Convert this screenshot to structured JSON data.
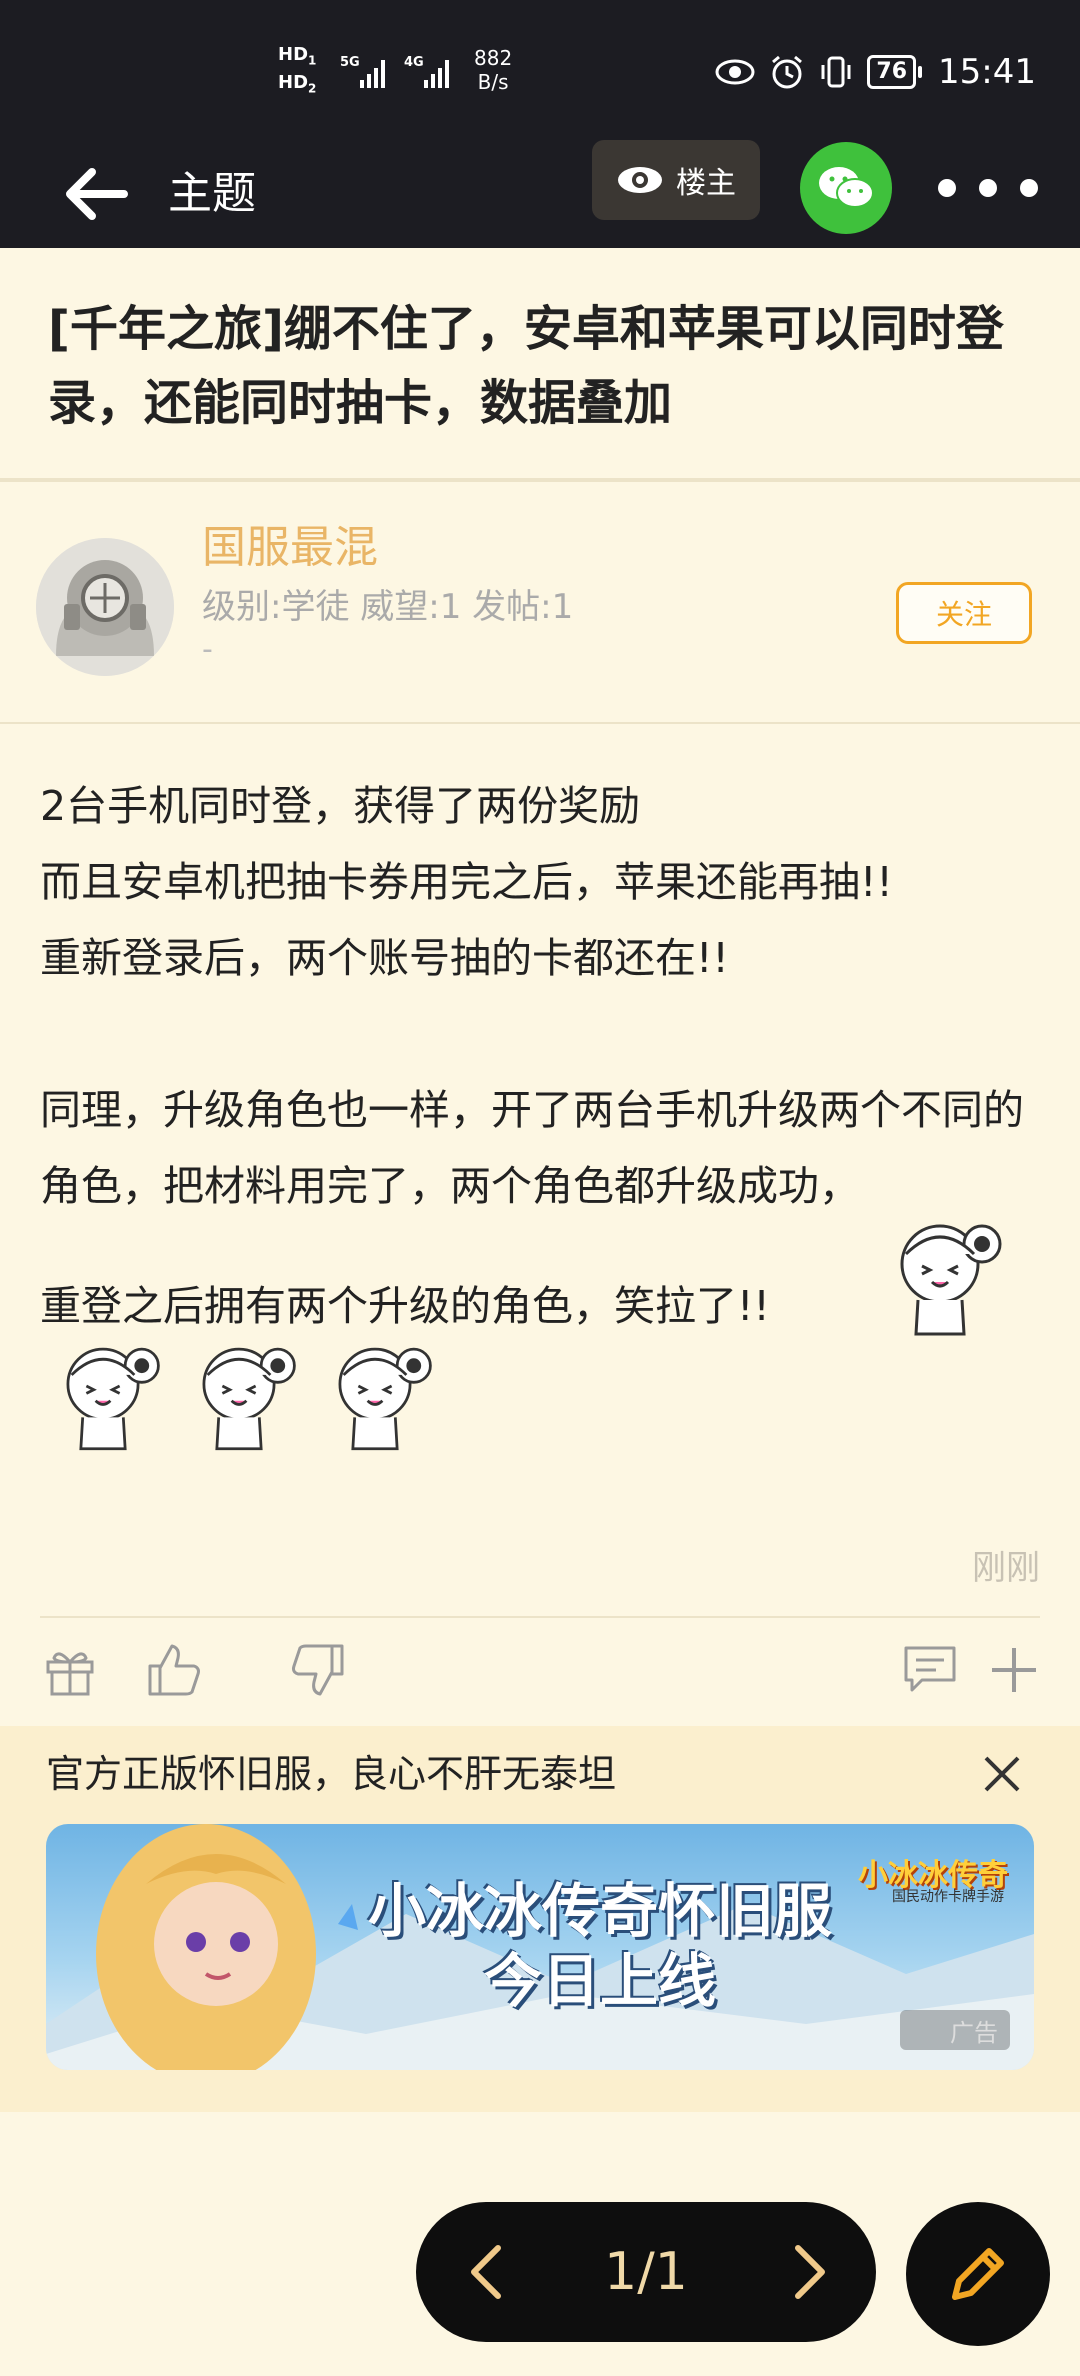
{
  "status_bar": {
    "net_label_1": "HD",
    "net_label_2": "HD",
    "sig1": "5G",
    "sig2": "4G",
    "speed_value": "882",
    "speed_unit": "B/s",
    "battery": "76",
    "time": "15:41"
  },
  "header": {
    "title": "主题",
    "owner_label": "楼主"
  },
  "post": {
    "title": "[千年之旅]绷不住了，安卓和苹果可以同时登录，还能同时抽卡，数据叠加",
    "author": {
      "name": "国服最混",
      "meta": "级别:学徒 威望:1 发帖:1",
      "dash": "-",
      "follow_label": "关注"
    },
    "body": {
      "line1": "2台手机同时登，获得了两份奖励",
      "line2": "而且安卓机把抽卡券用完之后，苹果还能再抽!!",
      "line3": "重新登录后，两个账号抽的卡都还在!!",
      "line4": "",
      "line5": "同理，升级角色也一样，开了两台手机升级两个不同的角色，把材料用完了，两个角色都升级成功，",
      "line6": "重登之后拥有两个升级的角色，笑拉了!!"
    },
    "time": "刚刚"
  },
  "ad": {
    "text": "官方正版怀旧服，良心不肝无泰坦",
    "banner_main": "小冰冰传奇怀旧服",
    "banner_sub": "今日上线",
    "banner_logo": "小冰冰传奇",
    "banner_logo_sub": "国民动作卡牌手游",
    "label": "广告"
  },
  "pager": {
    "text": "1/1"
  },
  "colors": {
    "page_bg": "#fdf7e3",
    "bar_bg": "#1c1c22",
    "author_accent": "#e9b566",
    "follow_accent": "#f2a623",
    "wechat": "#3fc13c"
  }
}
